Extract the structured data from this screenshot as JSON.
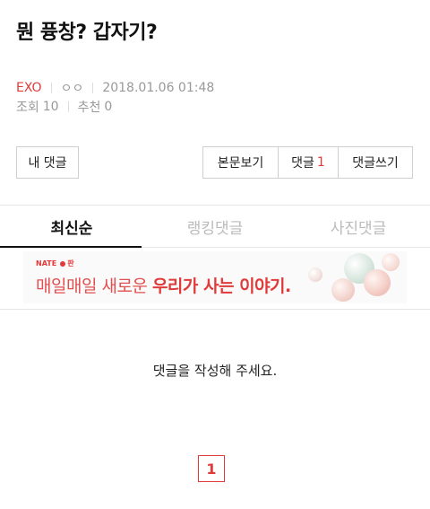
{
  "post": {
    "title": "뭔 퓽창? 갑자기?",
    "category": "EXO",
    "author": "ㅇㅇ",
    "datetime": "2018.01.06 01:48",
    "views_label": "조회",
    "views": "10",
    "recommend_label": "추천",
    "recommend": "0"
  },
  "buttons": {
    "my_comments": "내 댓글",
    "view_body": "본문보기",
    "comments_label": "댓글",
    "comments_count": "1",
    "write_comment": "댓글쓰기"
  },
  "tabs": [
    {
      "label": "최신순",
      "active": true
    },
    {
      "label": "랭킹댓글",
      "active": false
    },
    {
      "label": "사진댓글",
      "active": false
    }
  ],
  "banner": {
    "brand": "NATE",
    "brand_suffix": "판",
    "headline_normal": "매일매일 새로운 ",
    "headline_strong": "우리가 사는 이야기."
  },
  "empty_message": "댓글을 작성해 주세요.",
  "pagination": {
    "current": "1"
  },
  "colors": {
    "accent": "#e03a3a",
    "muted": "#999999",
    "border": "#cfcfcf"
  }
}
